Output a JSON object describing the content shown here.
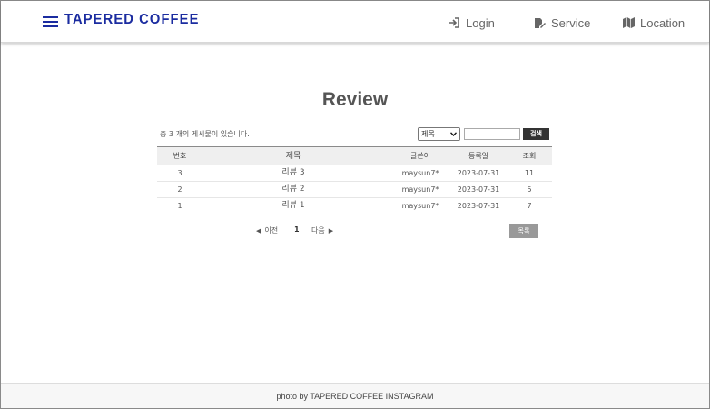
{
  "header": {
    "logo": "TAPERED COFFEE",
    "menu_icon": "hamburger-menu-icon",
    "nav": [
      {
        "label": "Login",
        "icon": "login-arrow-icon"
      },
      {
        "label": "Service",
        "icon": "edit-document-icon"
      },
      {
        "label": "Location",
        "icon": "map-icon"
      }
    ],
    "brand_color": "#1b2ca0"
  },
  "main": {
    "title": "Review",
    "count_text": "총 3 개의 게시물이 있습니다.",
    "search": {
      "field_selected": "제목",
      "input_value": "",
      "button_label": "검색"
    },
    "table": {
      "headers": {
        "no": "번호",
        "title": "제목",
        "writer": "글쓴이",
        "date": "등록일",
        "views": "조회"
      },
      "rows": [
        {
          "no": "3",
          "title": "리뷰 3",
          "writer": "maysun7*",
          "date": "2023-07-31",
          "views": "11"
        },
        {
          "no": "2",
          "title": "리뷰 2",
          "writer": "maysun7*",
          "date": "2023-07-31",
          "views": "5"
        },
        {
          "no": "1",
          "title": "리뷰 1",
          "writer": "maysun7*",
          "date": "2023-07-31",
          "views": "7"
        }
      ]
    },
    "pagination": {
      "prev_label": "이전",
      "current_page": "1",
      "next_label": "다음"
    },
    "list_button": "목록"
  },
  "footer": {
    "text": "photo by TAPERED COFFEE INSTAGRAM"
  }
}
